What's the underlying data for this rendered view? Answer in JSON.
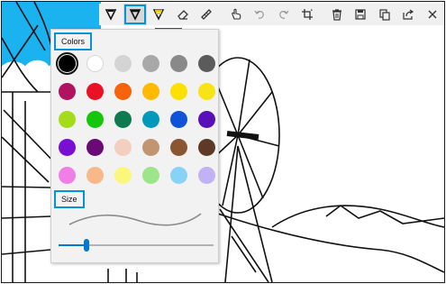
{
  "toolbar": {
    "tools": [
      {
        "name": "ballpoint-pen-icon",
        "selected": false
      },
      {
        "name": "pencil-icon",
        "selected": true
      },
      {
        "name": "highlighter-icon",
        "selected": false
      },
      {
        "name": "eraser-icon",
        "selected": false
      },
      {
        "name": "ruler-icon",
        "selected": false
      }
    ],
    "actions": [
      "touch-writing-icon",
      "undo-icon",
      "redo-icon",
      "crop-icon",
      "delete-icon",
      "save-icon",
      "copy-icon",
      "share-icon",
      "close-icon"
    ],
    "highlight_color": "#0094d8"
  },
  "panel": {
    "colors_label": "Colors",
    "size_label": "Size",
    "swatches": [
      "#000000",
      "#ffffff",
      "#d4d4d4",
      "#a8a8a8",
      "#898989",
      "#5b5b5b",
      "#b0135f",
      "#e81224",
      "#f7630c",
      "#ffb900",
      "#fce100",
      "#f8e316",
      "#a5dc1a",
      "#16c60c",
      "#0e7a4f",
      "#0099bc",
      "#0f53d6",
      "#5a10b8",
      "#7a0fd4",
      "#6a0a76",
      "#f2cfbf",
      "#c19570",
      "#8a5631",
      "#5c3a26",
      "#f17ee8",
      "#f9b88a",
      "#fbf67c",
      "#9de58b",
      "#86d3f7",
      "#c2b2f5"
    ],
    "selected_swatch": 0,
    "size_level": 0.18,
    "accent": "#0078d7"
  }
}
